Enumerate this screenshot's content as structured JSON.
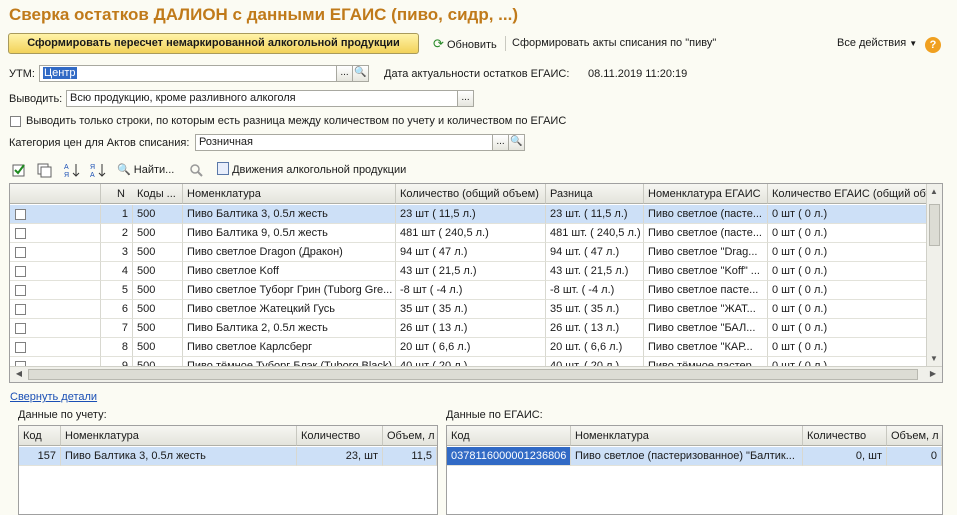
{
  "title": "Сверка остатков ДАЛИОН с данными ЕГАИС (пиво, сидр, ...)",
  "toolbar": {
    "primary": "Сформировать пересчет немаркированной алкогольной продукции",
    "refresh": "Обновить",
    "acts": "Сформировать акты списания по \"пиву\"",
    "all_actions": "Все действия",
    "help": "?"
  },
  "utm": {
    "label": "УТМ:",
    "value": "Центр",
    "date_label": "Дата актуальности остатков ЕГАИС:",
    "date_value": "08.11.2019 11:20:19"
  },
  "output": {
    "label": "Выводить:",
    "value": "Всю продукцию, кроме разливного алкоголя"
  },
  "only_diff_label": "Выводить только строки, по которым есть разница между количеством по учету и количеством по ЕГАИС",
  "price": {
    "label": "Категория цен для Актов списания:",
    "value": "Розничная"
  },
  "grid_toolbar": {
    "find": "Найти...",
    "movements": "Движения алкогольной продукции"
  },
  "grid": {
    "headers": [
      "",
      "N",
      "Коды ...",
      "Номенклатура",
      "Количество (общий объем)",
      "Разница",
      "Номенклатура ЕГАИС",
      "Количество ЕГАИС (общий объем)"
    ],
    "rows": [
      [
        "1",
        "500",
        "Пиво Балтика 3, 0.5л жесть",
        "23 шт ( 11,5 л.)",
        "23 шт. ( 11,5 л.)",
        "Пиво светлое (пасте...",
        "0 шт ( 0 л.)"
      ],
      [
        "2",
        "500",
        "Пиво Балтика 9, 0.5л жесть",
        "481 шт ( 240,5 л.)",
        "481 шт. ( 240,5 л.)",
        "Пиво светлое (пасте...",
        "0 шт ( 0 л.)"
      ],
      [
        "3",
        "500",
        "Пиво светлое Dragon (Дракон)",
        "94 шт ( 47 л.)",
        "94 шт. ( 47 л.)",
        "Пиво светлое \"Drag...",
        "0 шт ( 0 л.)"
      ],
      [
        "4",
        "500",
        "Пиво светлое Koff",
        "43 шт ( 21,5 л.)",
        "43 шт. ( 21,5 л.)",
        "Пиво светлое \"Koff\" ...",
        "0 шт ( 0 л.)"
      ],
      [
        "5",
        "500",
        "Пиво светлое Туборг Грин (Tuborg Gre...",
        "-8 шт ( -4 л.)",
        "-8 шт. ( -4 л.)",
        "Пиво светлое пасте...",
        "0 шт ( 0 л.)"
      ],
      [
        "6",
        "500",
        "Пиво светлое Жатецкий Гусь",
        "35 шт ( 35 л.)",
        "35 шт. ( 35 л.)",
        "Пиво светлое \"ЖАТ...",
        "0 шт ( 0 л.)"
      ],
      [
        "7",
        "500",
        "Пиво Балтика 2, 0.5л жесть",
        "26 шт ( 13 л.)",
        "26 шт. ( 13 л.)",
        "Пиво светлое \"БАЛ...",
        "0 шт ( 0 л.)"
      ],
      [
        "8",
        "500",
        "Пиво светлое Карлсберг",
        "20 шт ( 6,6 л.)",
        "20 шт. ( 6,6 л.)",
        "Пиво светлое \"КАР...",
        "0 шт ( 0 л.)"
      ],
      [
        "9",
        "500",
        "Пиво тёмное Туборг Блэк (Tuborg Black)",
        "40 шт ( 20 л.)",
        "40 шт. ( 20 л.)",
        "Пиво тёмное пастер...",
        "0 шт ( 0 л.)"
      ]
    ]
  },
  "collapse_link": "Свернуть детали",
  "accounting": {
    "label": "Данные по учету:",
    "headers": [
      "Код",
      "Номенклатура",
      "Количество",
      "Объем, л"
    ],
    "row": [
      "157",
      "Пиво Балтика 3, 0.5л жесть",
      "23, шт",
      "11,5"
    ]
  },
  "egais": {
    "label": "Данные по ЕГАИС:",
    "headers": [
      "Код",
      "Номенклатура",
      "Количество",
      "Объем, л"
    ],
    "row": [
      "0378116000001236806",
      "Пиво светлое (пастеризованное) \"Балтик...",
      "0, шт",
      "0"
    ]
  },
  "colors": {
    "title": "#c07a1a",
    "selection": "#cde0f7",
    "accent_button": "#f2d25a"
  }
}
